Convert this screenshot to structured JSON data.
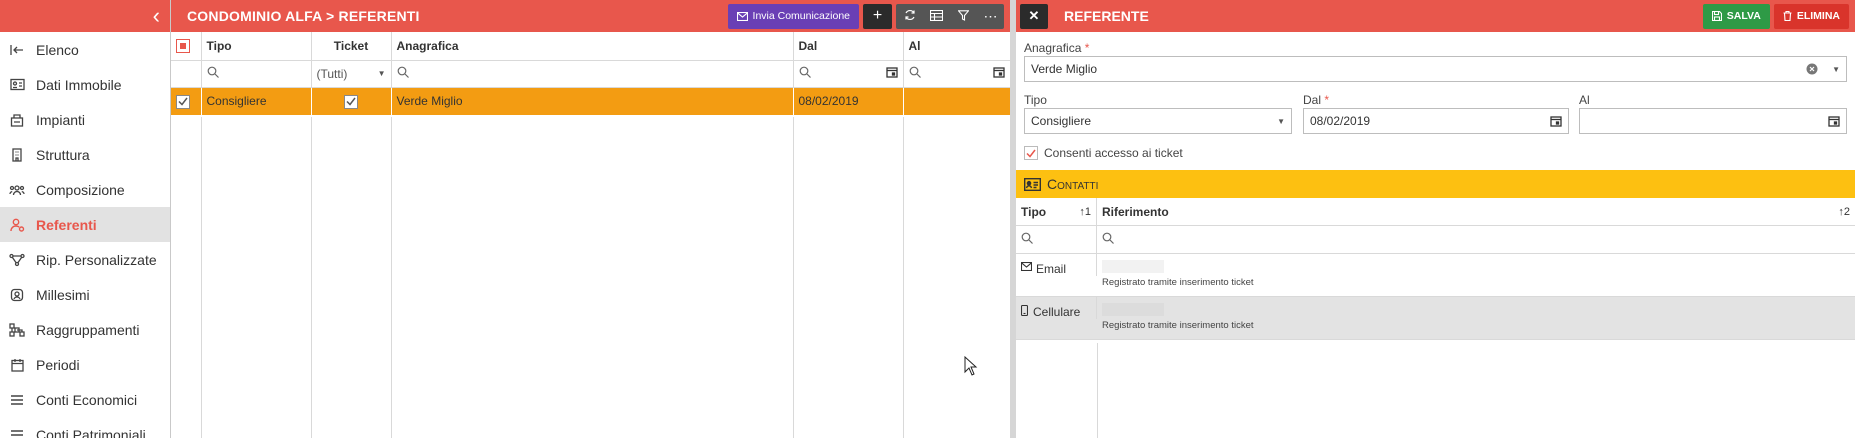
{
  "sidebar": {
    "items": [
      {
        "label": "Elenco",
        "icon": "sign-in-icon"
      },
      {
        "label": "Dati Immobile",
        "icon": "id-card-icon"
      },
      {
        "label": "Impianti",
        "icon": "server-icon"
      },
      {
        "label": "Struttura",
        "icon": "building-icon"
      },
      {
        "label": "Composizione",
        "icon": "users-icon"
      },
      {
        "label": "Referenti",
        "icon": "user-icon",
        "active": true
      },
      {
        "label": "Rip. Personalizzate",
        "icon": "nodes-icon"
      },
      {
        "label": "Millesimi",
        "icon": "badge-icon"
      },
      {
        "label": "Raggruppamenti",
        "icon": "sitemap-icon"
      },
      {
        "label": "Periodi",
        "icon": "calendar-icon"
      },
      {
        "label": "Conti Economici",
        "icon": "list-icon"
      },
      {
        "label": "Conti Patrimoniali",
        "icon": "list-icon"
      }
    ]
  },
  "list": {
    "title": "CONDOMINIO ALFA > REFERENTI",
    "invia_label": "Invia Comunicazione",
    "columns": {
      "tipo": "Tipo",
      "ticket": "Ticket",
      "anagrafica": "Anagrafica",
      "dal": "Dal",
      "al": "Al"
    },
    "filter_ticket": "(Tutti)",
    "rows": [
      {
        "tipo": "Consigliere",
        "ticket": true,
        "anagrafica": "Verde Miglio",
        "dal": "08/02/2019",
        "al": ""
      }
    ]
  },
  "detail": {
    "title": "REFERENTE",
    "salva_label": "SALVA",
    "elimina_label": "ELIMINA",
    "anagrafica_label": "Anagrafica",
    "anagrafica_value": "Verde Miglio",
    "tipo_label": "Tipo",
    "tipo_value": "Consigliere",
    "dal_label": "Dal",
    "dal_value": "08/02/2019",
    "al_label": "Al",
    "al_value": "",
    "consenti_label": "Consenti accesso ai ticket",
    "contatti_title": "Contatti",
    "contatti_columns": {
      "tipo": "Tipo",
      "tipo_sort": "1",
      "riferimento": "Riferimento",
      "riferimento_sort": "2"
    },
    "contatti": [
      {
        "tipo": "Email",
        "icon": "envelope-icon",
        "note": "Registrato tramite inserimento ticket"
      },
      {
        "tipo": "Cellulare",
        "icon": "mobile-icon",
        "note": "Registrato tramite inserimento ticket"
      }
    ]
  },
  "colors": {
    "header_red": "#e8574c",
    "selected_row_orange": "#f39c12",
    "contatti_yellow": "#fdc011",
    "invia_purple": "#6a3fb5",
    "salva_green": "#2e9a46",
    "elimina_red": "#d9342b"
  }
}
